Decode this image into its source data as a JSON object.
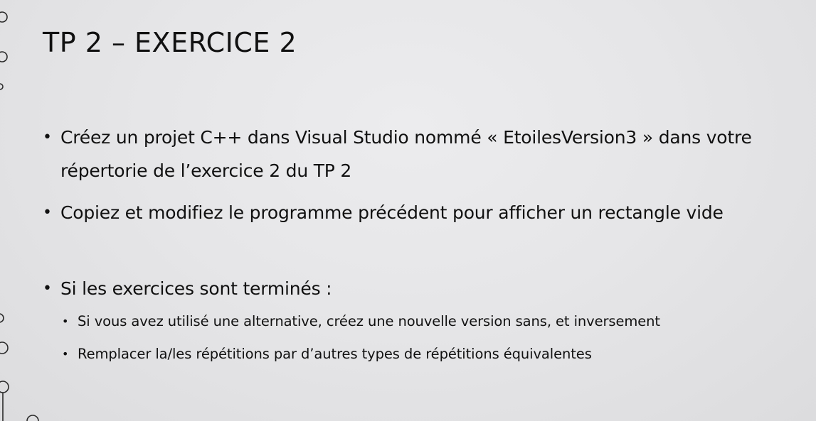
{
  "slide": {
    "title": "TP 2 – EXERCICE 2",
    "bullet_glyph": "•",
    "items": [
      {
        "text": "Créez un projet C++ dans Visual Studio nommé « EtoilesVersion3 » dans votre répertorie de l’exercice 2 du TP 2"
      },
      {
        "text": "Copiez et modifiez le programme précédent pour afficher un rectangle vide"
      },
      {
        "text": "Si les exercices sont terminés :",
        "subitems": [
          {
            "text": "Si vous avez utilisé une alternative, créez une nouvelle version sans, et inversement"
          },
          {
            "text": "Remplacer la/les répétitions par d’autres types de répétitions équivalentes"
          }
        ]
      }
    ]
  },
  "colors": {
    "text": "#111111",
    "background": "#e6e6e8",
    "ornament": "#2a2a2a"
  }
}
